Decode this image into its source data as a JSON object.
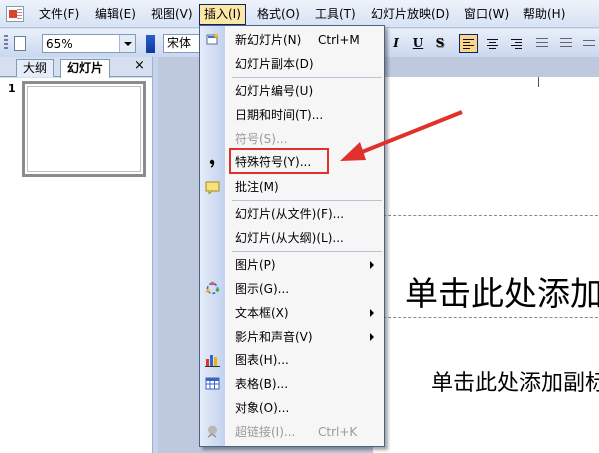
{
  "menubar": {
    "items": [
      {
        "label": "文件(F)"
      },
      {
        "label": "编辑(E)"
      },
      {
        "label": "视图(V)"
      },
      {
        "label": "插入(I)"
      },
      {
        "label": "格式(O)"
      },
      {
        "label": "工具(T)"
      },
      {
        "label": "幻灯片放映(D)"
      },
      {
        "label": "窗口(W)"
      },
      {
        "label": "帮助(H)"
      }
    ]
  },
  "toolbar": {
    "zoom": "65%",
    "font": "宋体",
    "italic": "I",
    "underline": "U",
    "shadow": "S"
  },
  "left_pane": {
    "tabs": [
      {
        "label": "大纲"
      },
      {
        "label": "幻灯片"
      }
    ],
    "close": "×",
    "slide_number": "1"
  },
  "slide": {
    "title": "单击此处添加标题",
    "subtitle": "单击此处添加副标题"
  },
  "insert_menu": {
    "items": [
      {
        "label": "新幻灯片(N)",
        "shortcut": "Ctrl+M"
      },
      {
        "label": "幻灯片副本(D)"
      },
      {
        "label": "幻灯片编号(U)"
      },
      {
        "label": "日期和时间(T)..."
      },
      {
        "label": "符号(S)..."
      },
      {
        "label": "特殊符号(Y)..."
      },
      {
        "label": "批注(M)"
      },
      {
        "label": "幻灯片(从文件)(F)..."
      },
      {
        "label": "幻灯片(从大纲)(L)..."
      },
      {
        "label": "图片(P)"
      },
      {
        "label": "图示(G)..."
      },
      {
        "label": "文本框(X)"
      },
      {
        "label": "影片和声音(V)"
      },
      {
        "label": "图表(H)..."
      },
      {
        "label": "表格(B)..."
      },
      {
        "label": "对象(O)..."
      },
      {
        "label": "超链接(I)...",
        "shortcut": "Ctrl+K"
      }
    ]
  },
  "colors": {
    "highlight": "#e0312c",
    "menu_active": "#fde7a6",
    "icon_strip": "#c3d2ee"
  }
}
